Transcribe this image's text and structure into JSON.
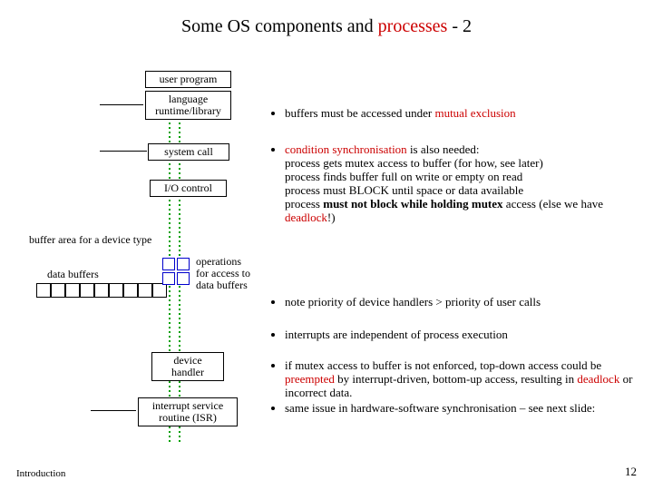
{
  "title_pre": "Some OS components and ",
  "title_red": "processes",
  "title_post": " - 2",
  "boxes": {
    "user_program": "user program",
    "language_runtime": "language\nruntime/library",
    "system_call": "system call",
    "io_control": "I/O control",
    "device_handler": "device\nhandler",
    "isr": "interrupt service\nroutine (ISR)"
  },
  "labels": {
    "buffer_area": "buffer area for a device type",
    "data_buffers": "data buffers",
    "operations": "operations\nfor access to\ndata buffers"
  },
  "bullets": {
    "b1_pre": "buffers must be accessed under ",
    "b1_red": "mutual exclusion",
    "b2_pre": "condition synchronisation",
    "b2_text": " is also needed:\nprocess gets mutex access to buffer (for how, see later)\nprocess finds buffer full on write or empty on read\nprocess must BLOCK until space or data available\nprocess ",
    "b2_bold": "must not block while holding mutex",
    "b2_post": " access (else we have ",
    "b2_red": "deadlock",
    "b2_end": "!)",
    "b3": "note priority of device handlers > priority of user calls",
    "b4": "interrupts are independent of process execution",
    "b5_pre": " if mutex access to buffer is not enforced, top-down access could be ",
    "b5_red1": "preempted",
    "b5_mid": " by interrupt-driven, bottom-up access, resulting in ",
    "b5_red2": "deadlock",
    "b5_post": " or incorrect data.",
    "b5_line2": "same issue in hardware-software synchronisation – see next slide:"
  },
  "footer": {
    "left": "Introduction",
    "right": "12"
  }
}
